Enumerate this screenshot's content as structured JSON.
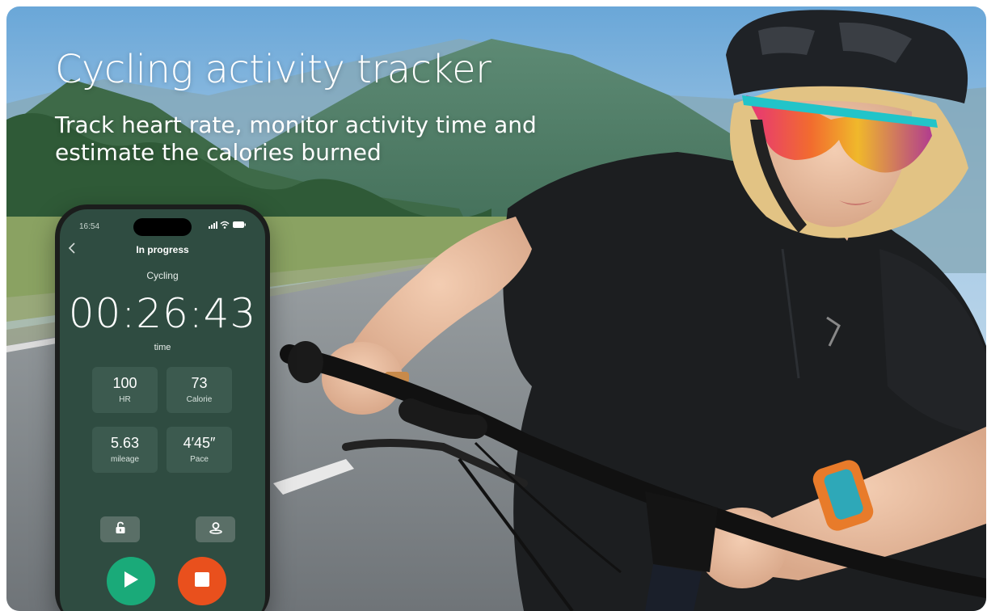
{
  "hero": {
    "title": "Cycling activity tracker",
    "subtitle": "Track heart rate, monitor activity time and estimate the calories burned"
  },
  "phone": {
    "status_time": "16:54",
    "status_icons": "signal-wifi-battery",
    "header_title": "In progress",
    "activity": "Cycling",
    "timer": "00:26:43",
    "timer_label": "time",
    "stats": [
      {
        "value": "100",
        "label": "HR"
      },
      {
        "value": "73",
        "label": "Calorie"
      },
      {
        "value": "5.63",
        "label": "mileage"
      },
      {
        "value": "4′45″",
        "label": "Pace"
      }
    ],
    "icons": {
      "lock": "lock-open-icon",
      "location": "location-pin-icon",
      "play": "play-icon",
      "stop": "stop-icon"
    }
  },
  "colors": {
    "screen_bg": "#2f4c41",
    "card_bg": "#3c5a4f",
    "play_button": "#1aaa79",
    "stop_button": "#e9501d"
  }
}
